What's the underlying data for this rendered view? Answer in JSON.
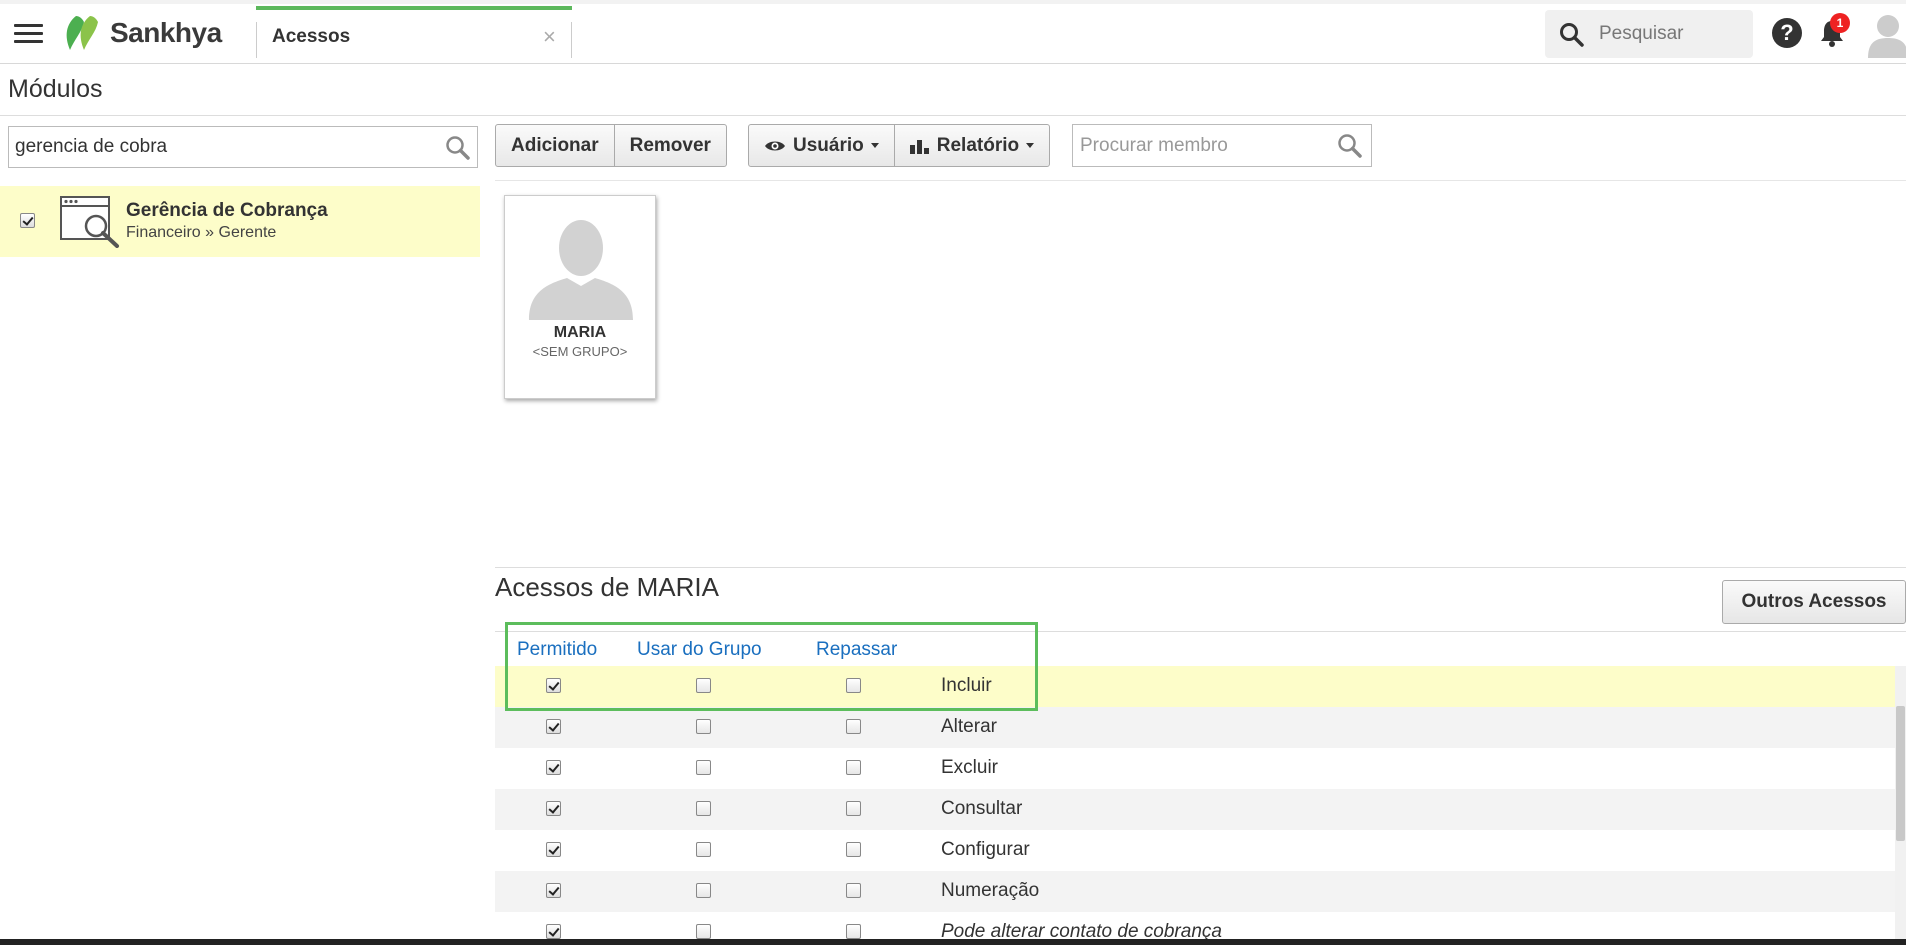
{
  "header": {
    "logo_text": "Sankhya",
    "tab_label": "Acessos",
    "tab_close": "×",
    "search_placeholder": "Pesquisar",
    "help_label": "?",
    "notification_count": "1"
  },
  "page": {
    "title": "Módulos"
  },
  "left_panel": {
    "search_value": "gerencia de cobra",
    "module": {
      "name": "Gerência de Cobrança",
      "path": "Financeiro » Gerente",
      "checked": true
    }
  },
  "toolbar": {
    "add_label": "Adicionar",
    "remove_label": "Remover",
    "user_label": "Usuário",
    "report_label": "Relatório",
    "member_search_placeholder": "Procurar membro"
  },
  "member": {
    "name": "MARIA",
    "group": "<SEM GRUPO>"
  },
  "access": {
    "title": "Acessos de MARIA",
    "other_access_label": "Outros Acessos",
    "columns": [
      "Permitido",
      "Usar do Grupo",
      "Repassar"
    ],
    "rows": [
      {
        "label": "Incluir",
        "permitido": true,
        "usar_grupo": false,
        "repassar": false
      },
      {
        "label": "Alterar",
        "permitido": true,
        "usar_grupo": false,
        "repassar": false
      },
      {
        "label": "Excluir",
        "permitido": true,
        "usar_grupo": false,
        "repassar": false
      },
      {
        "label": "Consultar",
        "permitido": true,
        "usar_grupo": false,
        "repassar": false
      },
      {
        "label": "Configurar",
        "permitido": true,
        "usar_grupo": false,
        "repassar": false
      },
      {
        "label": "Numeração",
        "permitido": true,
        "usar_grupo": false,
        "repassar": false
      },
      {
        "label": "Pode alterar contato de cobrança",
        "permitido": true,
        "usar_grupo": false,
        "repassar": false
      }
    ]
  },
  "colors": {
    "accent_green": "#5cb85c",
    "link_blue": "#1a6fbf",
    "selected_row": "#fdfdc9",
    "alt_row": "#f3f3f3",
    "badge_red": "#e22222"
  }
}
